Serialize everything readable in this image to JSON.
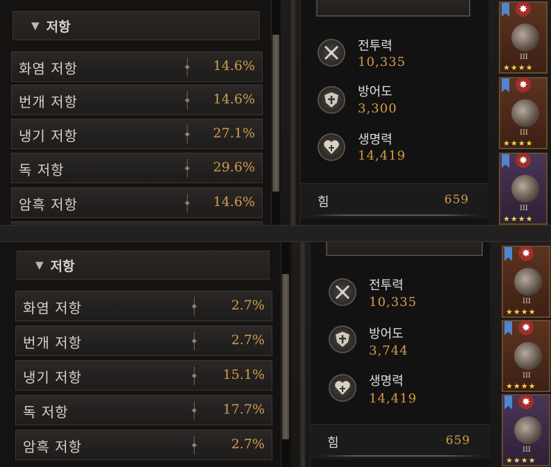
{
  "panels": {
    "top": {
      "resistance": {
        "header": "저항",
        "rows": [
          {
            "label": "화염 저항",
            "value": "14.6%"
          },
          {
            "label": "번개 저항",
            "value": "14.6%"
          },
          {
            "label": "냉기 저항",
            "value": "27.1%"
          },
          {
            "label": "독 저항",
            "value": "29.6%"
          },
          {
            "label": "암흑 저항",
            "value": "14.6%"
          }
        ]
      },
      "stats": [
        {
          "name": "전투력",
          "value": "10,335",
          "icon": "crossed-swords-icon"
        },
        {
          "name": "방어도",
          "value": "3,300",
          "icon": "shield-icon"
        },
        {
          "name": "생명력",
          "value": "14,419",
          "icon": "heart-icon"
        }
      ],
      "power": {
        "label": "힘",
        "value": "659"
      }
    },
    "bottom": {
      "resistance": {
        "header": "저항",
        "rows": [
          {
            "label": "화염 저항",
            "value": "2.7%"
          },
          {
            "label": "번개 저항",
            "value": "2.7%"
          },
          {
            "label": "냉기 저항",
            "value": "15.1%"
          },
          {
            "label": "독 저항",
            "value": "17.7%"
          },
          {
            "label": "암흑 저항",
            "value": "2.7%"
          }
        ]
      },
      "stats": [
        {
          "name": "전투력",
          "value": "10,335",
          "icon": "crossed-swords-icon"
        },
        {
          "name": "방어도",
          "value": "3,744",
          "icon": "shield-icon"
        },
        {
          "name": "생명력",
          "value": "14,419",
          "icon": "heart-icon"
        }
      ],
      "power": {
        "label": "힘",
        "value": "659"
      }
    }
  },
  "cards": {
    "roman": "III",
    "stars": "★★★★",
    "badge": "✸"
  },
  "colors": {
    "value_gold": "#d79f45",
    "resist_gold": "#cf9c4d",
    "bookmark_blue": "#4f86d2"
  }
}
